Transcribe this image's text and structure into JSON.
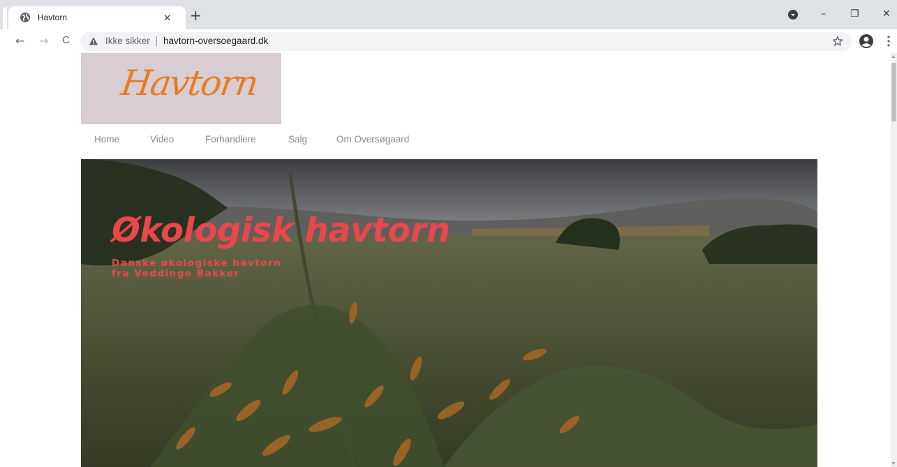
{
  "browser": {
    "tab": {
      "title": "Havtorn",
      "favicon": "globe-icon",
      "close": "×"
    },
    "new_tab": "+",
    "window_controls": {
      "minimize": "–",
      "restore": "❐",
      "close": "✕"
    },
    "nav": {
      "back": "←",
      "forward": "→",
      "reload": "C"
    },
    "address_bar": {
      "security_label": "Ikke sikker",
      "separator": "|",
      "url": "havtorn-oversoegaard.dk"
    }
  },
  "site": {
    "logo_text": "Havtorn",
    "nav": [
      "Home",
      "Video",
      "Forhandlere",
      "Salg",
      "Om Oversøgaard"
    ],
    "hero": {
      "title": "Økologisk havtorn",
      "subtitle_line1": "Danske økologiske havtorn",
      "subtitle_line2": "fra Veddinge Bakker"
    }
  },
  "colors": {
    "accent": "#e8474b",
    "logo_bg": "#d7cdd3",
    "logo_text": "#e67e22",
    "nav_text": "#8a8a8a"
  }
}
